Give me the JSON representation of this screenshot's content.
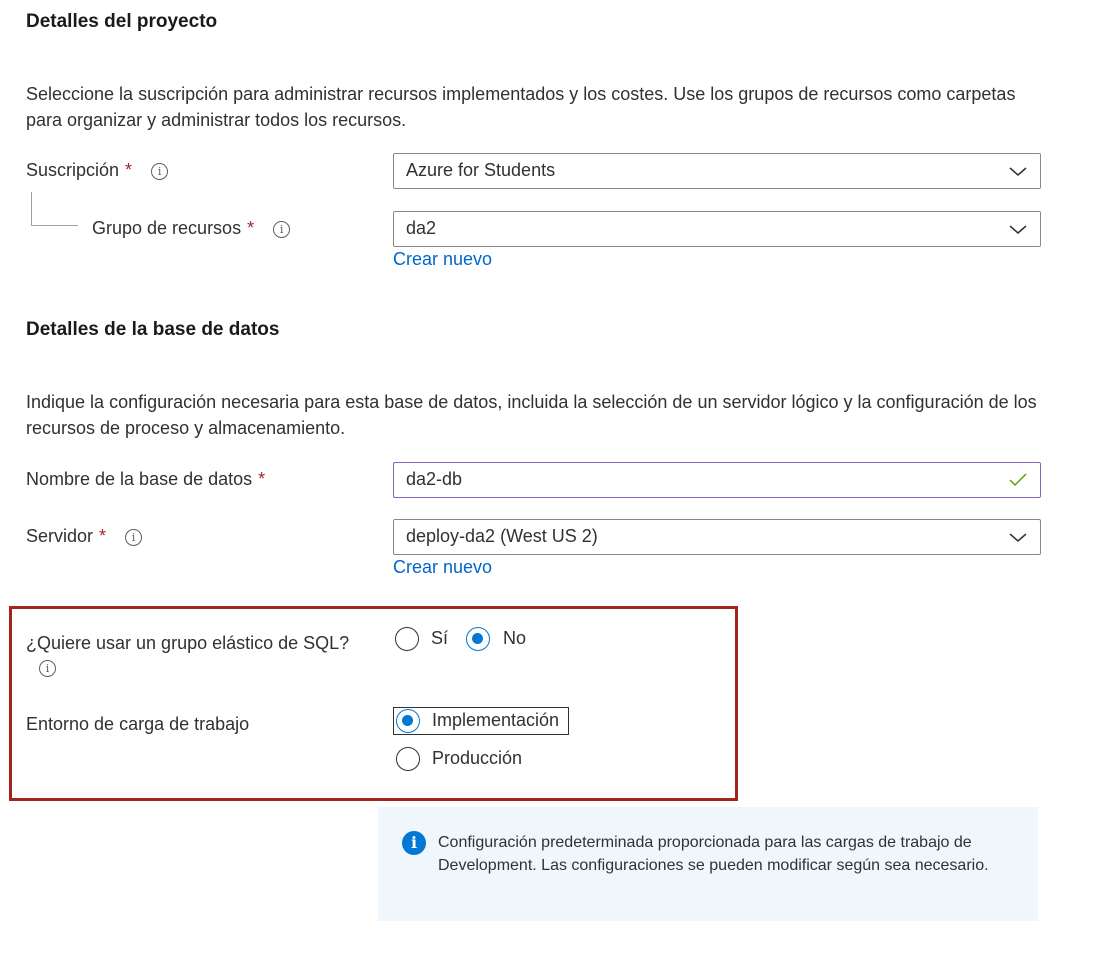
{
  "project": {
    "title": "Detalles del proyecto",
    "description": "Seleccione la suscripción para administrar recursos implementados y los costes. Use los grupos de recursos como carpetas para organizar y administrar todos los recursos.",
    "subscription": {
      "label": "Suscripción",
      "required_mark": "*",
      "value": "Azure for Students"
    },
    "resource_group": {
      "label": "Grupo de recursos",
      "required_mark": "*",
      "value": "da2",
      "create_link": "Crear nuevo"
    }
  },
  "database": {
    "title": "Detalles de la base de datos",
    "description": "Indique la configuración necesaria para esta base de datos, incluida la selección de un servidor lógico y la configuración de los recursos de proceso y almacenamiento.",
    "name": {
      "label": "Nombre de la base de datos",
      "required_mark": "*",
      "value": "da2-db"
    },
    "server": {
      "label": "Servidor",
      "required_mark": "*",
      "value": "deploy-da2 (West US 2)",
      "create_link": "Crear nuevo"
    },
    "elastic_pool": {
      "label": "¿Quiere usar un grupo elástico de SQL?",
      "options": [
        "Sí",
        "No"
      ],
      "selected": "No"
    },
    "workload": {
      "label": "Entorno de carga de trabajo",
      "options": [
        "Implementación",
        "Producción"
      ],
      "selected": "Implementación"
    },
    "info_message": "Configuración predeterminada proporcionada para las cargas de trabajo de Development. Las configuraciones se pueden modificar según sea necesario."
  },
  "icons": {
    "info": "i",
    "valid": "checkmark-icon",
    "dropdown": "chevron-down-icon"
  },
  "colors": {
    "required": "#a4262c",
    "link": "#0066cc",
    "accent": "#0078d4",
    "highlight_border": "#a3261c",
    "valid_check": "#57a300",
    "info_background": "#eff6fc"
  }
}
